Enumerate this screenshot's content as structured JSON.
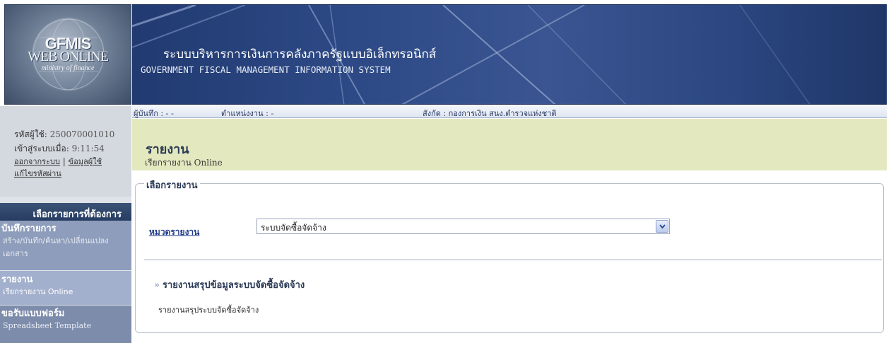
{
  "logo": {
    "line1": "GFMIS",
    "line2": "WEB ONLINE",
    "line3": "ministry of finance"
  },
  "banner": {
    "title_th": "ระบบบริหารการเงินการคลังภาครัฐแบบอิเล็กทรอนิกส์",
    "title_en": "GOVERNMENT FISCAL MANAGEMENT INFORMATION SYSTEM"
  },
  "user": {
    "id_label": "รหัสผู้ใช้:",
    "id_value": "250070001010",
    "login_label": "เข้าสู่ระบบเมื่อ:",
    "login_value": "9:11:54",
    "logout_link": "ออกจากระบบ",
    "separator": "|",
    "profile_link": "ข้อมูลผู้ใช้",
    "change_password_link": "แก้ไขรหัสผ่าน"
  },
  "menu": {
    "heading": "เลือกรายการที่ต้องการ",
    "items": [
      {
        "title": "บันทึกรายการ",
        "subtitle": "สร้าง/บันทึก/ค้นหา/เปลี่ยนแปลง เอกสาร"
      },
      {
        "title": "รายงาน",
        "subtitle": "เรียกรายงาน Online"
      },
      {
        "title": "ขอรับแบบฟอร์ม",
        "subtitle": "Spreadsheet Template"
      }
    ]
  },
  "infobar": {
    "recorder": "ผู้บันทึก :  - -",
    "position": "ตำแหน่งงาน :  -",
    "org": "สังกัด  : กองการเงิน สนง.ตำรวจแห่งชาติ"
  },
  "page": {
    "title": "รายงาน",
    "subtitle": "เรียกรายงาน Online"
  },
  "report_select": {
    "legend": "เลือกรายงาน",
    "category_label": "หมวดรายงาน",
    "category_value": "ระบบจัดซื้อจัดจ้าง",
    "section_heading": "รายงานสรุปข้อมูลระบบจัดซื้อจัดจ้าง",
    "section_arrow": "»",
    "report_link": "รายงานสรุประบบจัดซื้อจัดจ้าง"
  }
}
